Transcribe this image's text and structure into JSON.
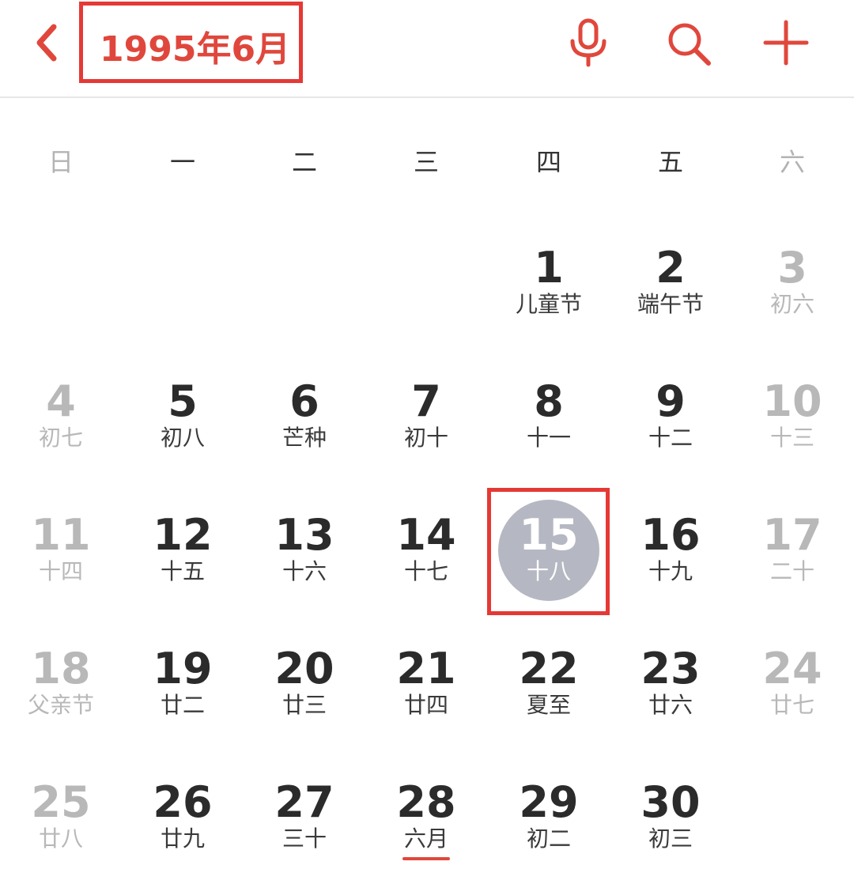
{
  "header": {
    "title": "1995年6月",
    "icons": {
      "back": "back-arrow-icon",
      "mic": "microphone-icon",
      "search": "search-icon",
      "add": "plus-icon"
    },
    "accent_color": "#e0473c"
  },
  "weekdays": [
    "日",
    "一",
    "二",
    "三",
    "四",
    "五",
    "六"
  ],
  "days": [
    {
      "num": "1",
      "sub": "儿童节"
    },
    {
      "num": "2",
      "sub": "端午节"
    },
    {
      "num": "3",
      "sub": "初六"
    },
    {
      "num": "4",
      "sub": "初七"
    },
    {
      "num": "5",
      "sub": "初八"
    },
    {
      "num": "6",
      "sub": "芒种"
    },
    {
      "num": "7",
      "sub": "初十"
    },
    {
      "num": "8",
      "sub": "十一"
    },
    {
      "num": "9",
      "sub": "十二"
    },
    {
      "num": "10",
      "sub": "十三"
    },
    {
      "num": "11",
      "sub": "十四"
    },
    {
      "num": "12",
      "sub": "十五"
    },
    {
      "num": "13",
      "sub": "十六"
    },
    {
      "num": "14",
      "sub": "十七"
    },
    {
      "num": "15",
      "sub": "十八"
    },
    {
      "num": "16",
      "sub": "十九"
    },
    {
      "num": "17",
      "sub": "二十"
    },
    {
      "num": "18",
      "sub": "父亲节"
    },
    {
      "num": "19",
      "sub": "廿二"
    },
    {
      "num": "20",
      "sub": "廿三"
    },
    {
      "num": "21",
      "sub": "廿四"
    },
    {
      "num": "22",
      "sub": "夏至"
    },
    {
      "num": "23",
      "sub": "廿六"
    },
    {
      "num": "24",
      "sub": "廿七"
    },
    {
      "num": "25",
      "sub": "廿八"
    },
    {
      "num": "26",
      "sub": "廿九"
    },
    {
      "num": "27",
      "sub": "三十"
    },
    {
      "num": "28",
      "sub": "六月"
    },
    {
      "num": "29",
      "sub": "初二"
    },
    {
      "num": "30",
      "sub": "初三"
    }
  ],
  "selected_day": "15",
  "colors": {
    "selected_bg": "#b5b8c2",
    "weekend_text": "#b8b8b8",
    "highlight_box": "#e53935"
  }
}
